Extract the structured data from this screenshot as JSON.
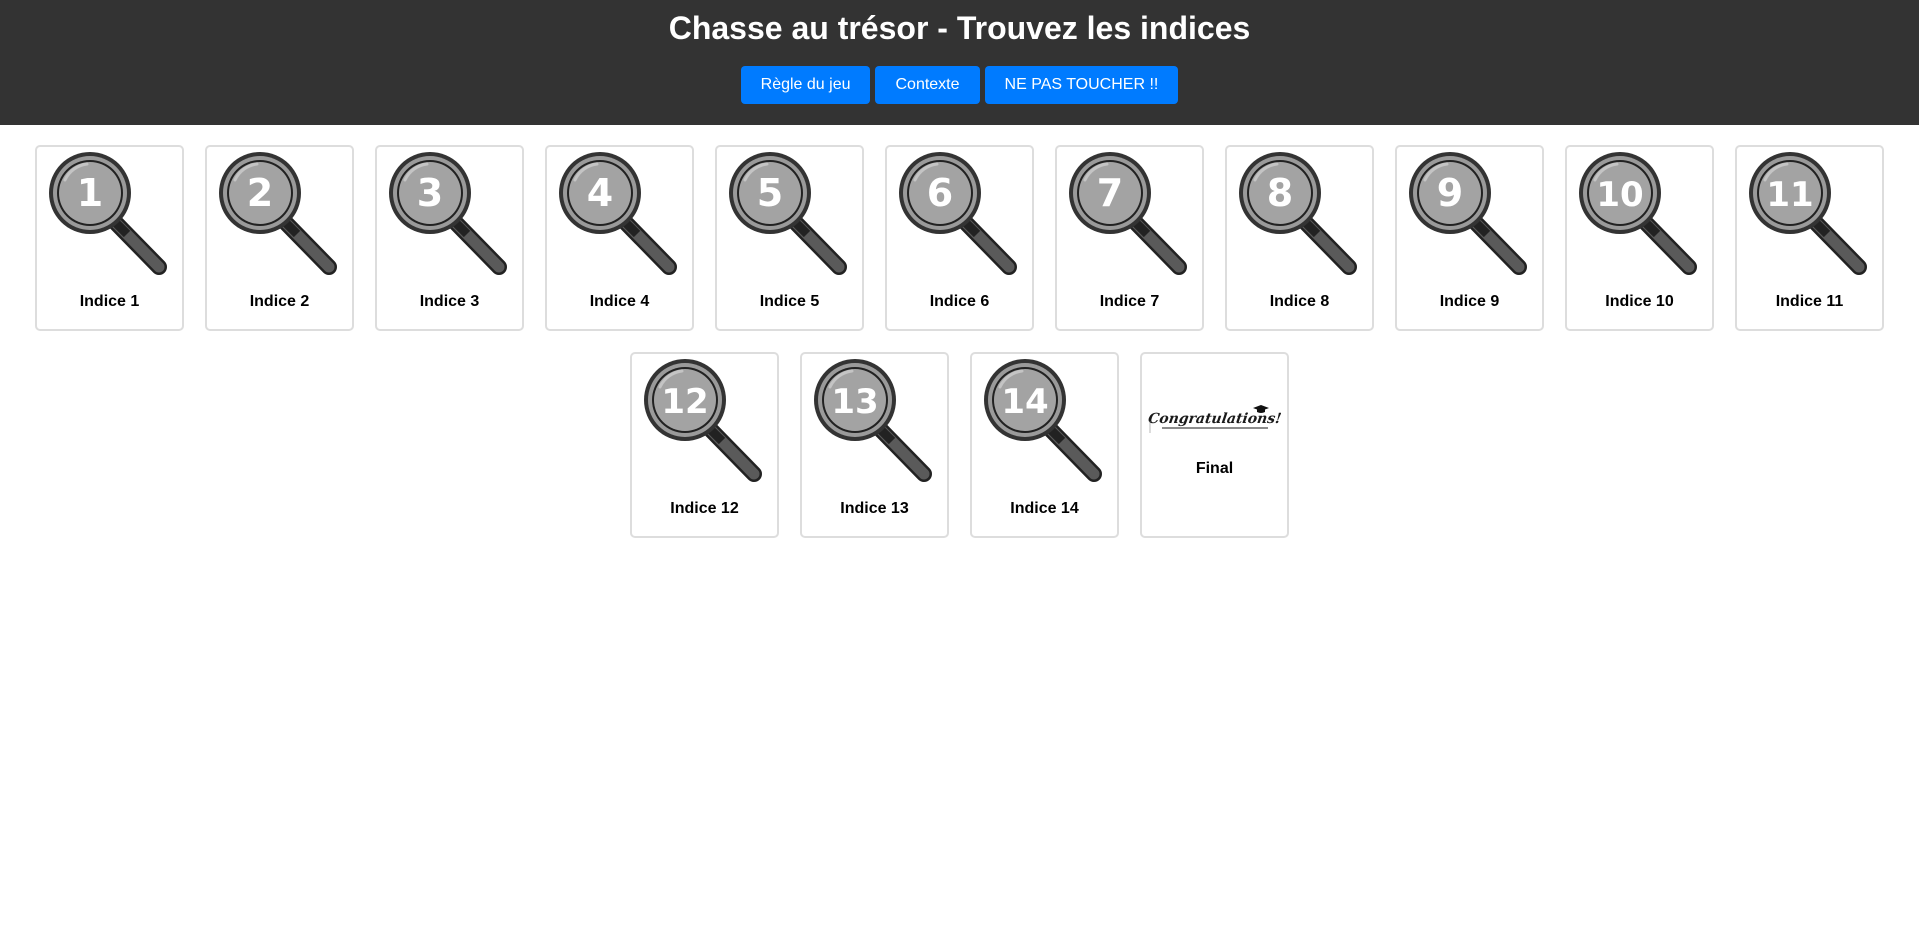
{
  "header": {
    "title": "Chasse au trésor - Trouvez les indices",
    "buttons": [
      "Règle du jeu",
      "Contexte",
      "NE PAS TOUCHER !!"
    ]
  },
  "colors": {
    "header_bg": "#333333",
    "button_bg": "#007bff",
    "card_border": "#dddddd"
  },
  "clues": [
    {
      "number": "1",
      "label": "Indice 1"
    },
    {
      "number": "2",
      "label": "Indice 2"
    },
    {
      "number": "3",
      "label": "Indice 3"
    },
    {
      "number": "4",
      "label": "Indice 4"
    },
    {
      "number": "5",
      "label": "Indice 5"
    },
    {
      "number": "6",
      "label": "Indice 6"
    },
    {
      "number": "7",
      "label": "Indice 7"
    },
    {
      "number": "8",
      "label": "Indice 8"
    },
    {
      "number": "9",
      "label": "Indice 9"
    },
    {
      "number": "10",
      "label": "Indice 10"
    },
    {
      "number": "11",
      "label": "Indice 11"
    },
    {
      "number": "12",
      "label": "Indice 12"
    },
    {
      "number": "13",
      "label": "Indice 13"
    },
    {
      "number": "14",
      "label": "Indice 14"
    }
  ],
  "final": {
    "image_text": "Congratulations!",
    "label": "Final"
  },
  "icons": {
    "clue": "magnifying-glass-icon",
    "final": "congratulations-image"
  }
}
